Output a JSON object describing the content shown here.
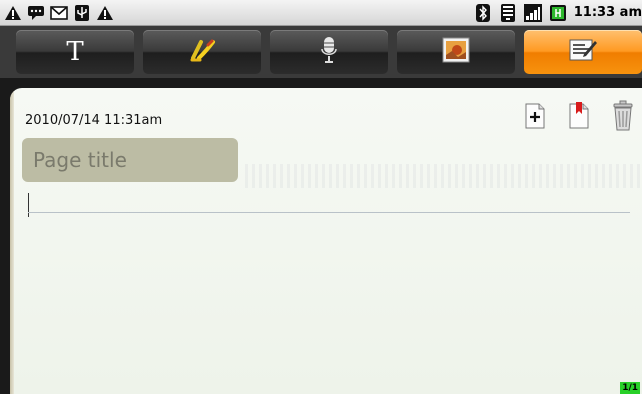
{
  "status_bar": {
    "left_icons": [
      "warning-icon",
      "chat-icon",
      "mail-icon",
      "usb-icon",
      "warning-icon"
    ],
    "right_icons": [
      "bluetooth-icon",
      "wifi-icon",
      "signal-icon",
      "battery-icon"
    ],
    "clock": "11:33 am"
  },
  "toolbar": {
    "tools": [
      {
        "name": "text-tool",
        "label": "T",
        "active": false
      },
      {
        "name": "draw-tool",
        "icon": "pen-icon",
        "active": false
      },
      {
        "name": "voice-tool",
        "icon": "microphone-icon",
        "active": false
      },
      {
        "name": "image-tool",
        "icon": "picture-icon",
        "active": false
      },
      {
        "name": "page-tool",
        "icon": "page-edit-icon",
        "active": true
      }
    ],
    "active_color": "#f7920e"
  },
  "page": {
    "timestamp": "2010/07/14  11:31am",
    "title_placeholder": "Page title",
    "title_value": "",
    "actions": [
      "add-page-icon",
      "bookmark-icon",
      "trash-icon"
    ],
    "page_indicator": "1/1"
  }
}
